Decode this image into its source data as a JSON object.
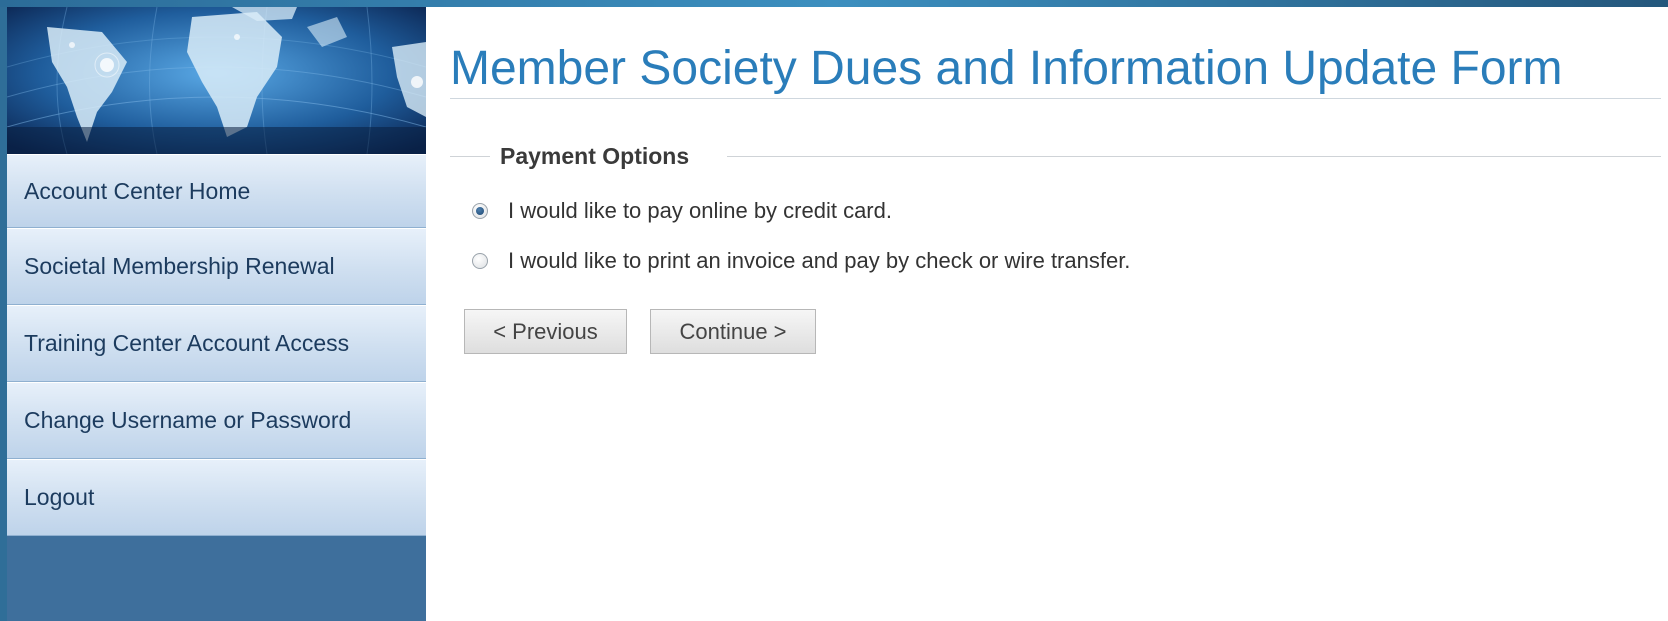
{
  "sidebar": {
    "banner_icon": "world-map-globe-image",
    "items": [
      {
        "label": "Account Center Home"
      },
      {
        "label": "Societal Membership Renewal"
      },
      {
        "label": "Training Center Account Access"
      },
      {
        "label": "Change Username or Password"
      },
      {
        "label": "Logout"
      }
    ]
  },
  "main": {
    "title": "Member Society Dues and Information Update Form",
    "payment": {
      "legend": "Payment Options",
      "options": [
        {
          "label": "I would like to pay online by credit card.",
          "checked": true
        },
        {
          "label": "I would like to print an invoice and pay by check or wire transfer.",
          "checked": false
        }
      ]
    },
    "buttons": {
      "previous": "< Previous",
      "continue": "Continue >"
    }
  },
  "colors": {
    "title": "#2a7dba",
    "sidebar_bg": "#3e6f9c",
    "nav_item_bg": "#cfdff0",
    "nav_text": "#1c3b5e"
  }
}
